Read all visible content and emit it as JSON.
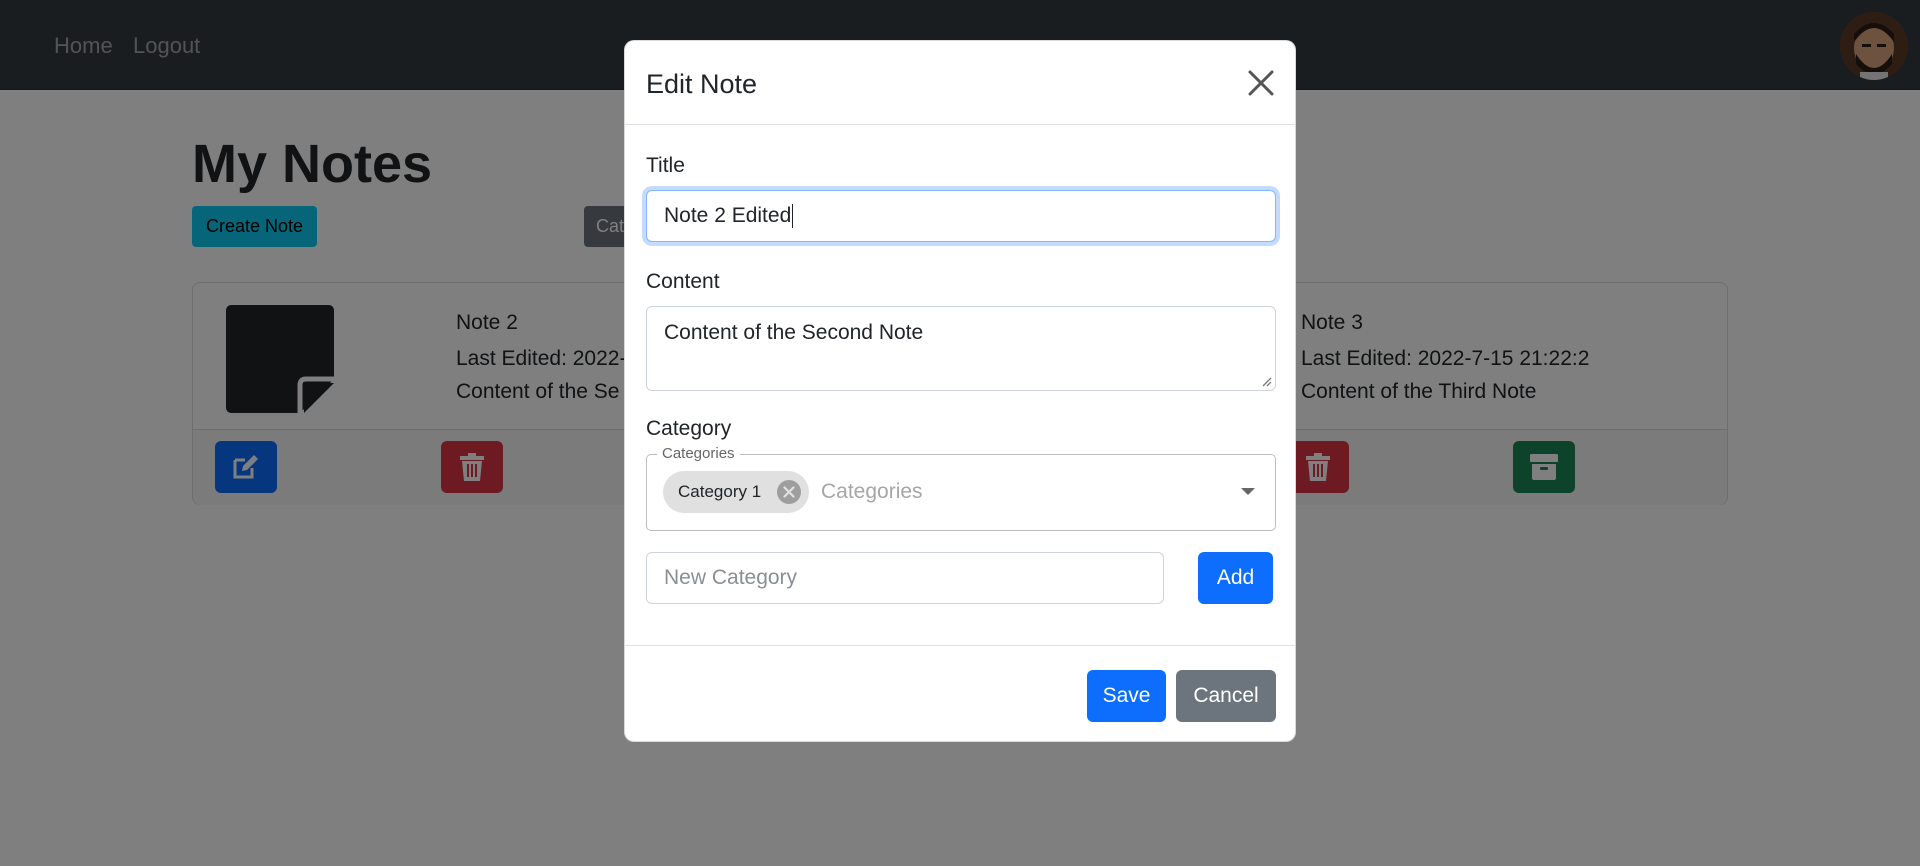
{
  "nav": {
    "home": "Home",
    "logout": "Logout"
  },
  "page": {
    "title": "My Notes",
    "create_button": "Create Note",
    "categories_button": "Cat"
  },
  "notes": [
    {
      "title": "Note 2",
      "last_edited": "Last Edited: 2022-",
      "content": "Content of the Se"
    },
    {
      "title": "Note 3",
      "last_edited": "Last Edited: 2022-7-15 21:22:2",
      "content": "Content of the Third Note"
    }
  ],
  "modal": {
    "title": "Edit Note",
    "title_label": "Title",
    "title_value": "Note 2 Edited",
    "content_label": "Content",
    "content_value": "Content of the Second Note",
    "category_label": "Category",
    "categories_legend": "Categories",
    "selected_chip": "Category 1",
    "categories_placeholder": "Categories",
    "new_category_placeholder": "New Category",
    "add_button": "Add",
    "save_button": "Save",
    "cancel_button": "Cancel"
  },
  "colors": {
    "primary": "#0d6efd",
    "danger": "#dc3545",
    "success": "#198754",
    "info": "#0dcaf0",
    "secondary": "#6c757d",
    "navbar": "#343a40"
  },
  "icons": {
    "close": "close-icon",
    "edit": "edit-icon",
    "delete": "trash-icon",
    "archive": "archive-icon",
    "note": "sticky-note-icon",
    "chip_remove": "remove-chip-icon",
    "dropdown": "chevron-down-icon"
  }
}
